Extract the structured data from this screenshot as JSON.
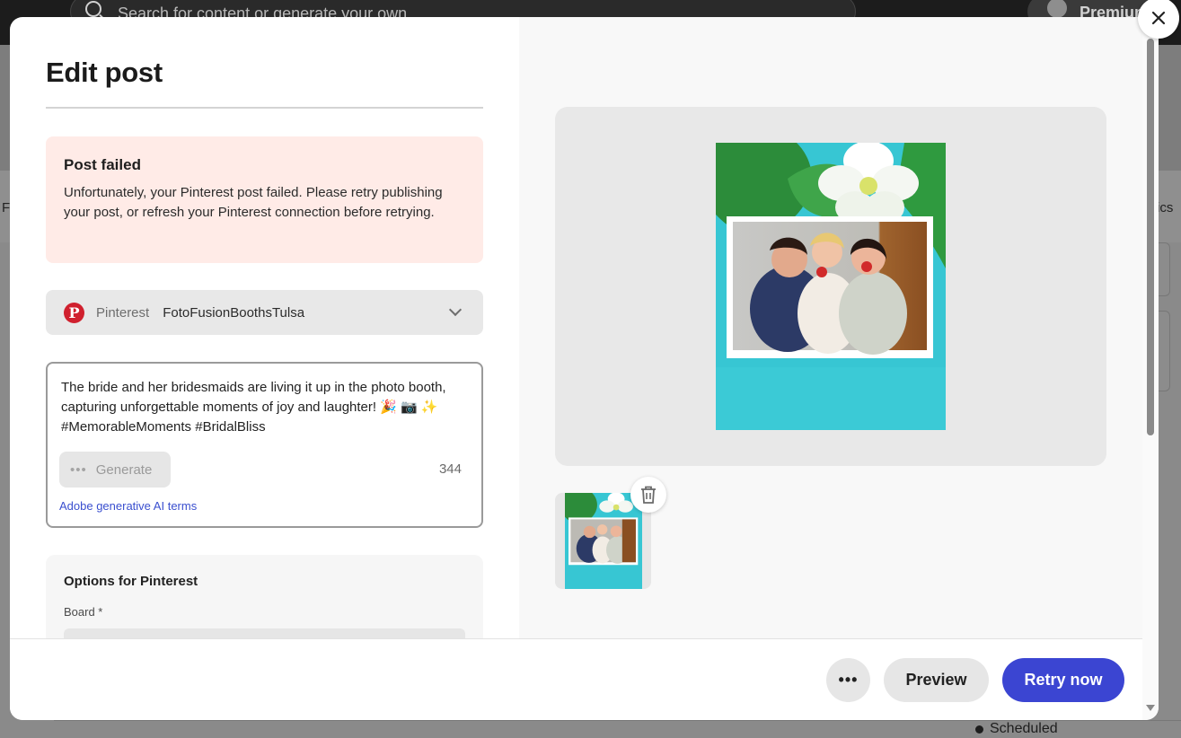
{
  "background": {
    "search_placeholder": "Search for content or generate your own",
    "premium_label": "Premium",
    "left_tab_fragment": "F",
    "right_tab_fragment": "ics",
    "status_label": "Scheduled"
  },
  "modal": {
    "title": "Edit post",
    "alert": {
      "title": "Post failed",
      "message": "Unfortunately, your Pinterest post failed. Please retry publishing your post, or refresh your Pinterest connection before retrying."
    },
    "account": {
      "network": "Pinterest",
      "name": "FotoFusionBoothsTulsa"
    },
    "caption": {
      "text": "The bride and her bridesmaids are living it up in the photo booth, capturing unforgettable moments of joy and laughter! 🎉 📷 ✨  #MemorableMoments #BridalBliss",
      "generate_label": "Generate",
      "char_count": "344",
      "ai_terms_link": "Adobe generative AI terms"
    },
    "options": {
      "title": "Options for Pinterest",
      "board_label": "Board *"
    },
    "footer": {
      "more_label": "•••",
      "preview_label": "Preview",
      "retry_label": "Retry now"
    }
  },
  "colors": {
    "accent": "#3b45d2",
    "alert_bg": "#ffebe7",
    "pinterest_red": "#d0202e"
  }
}
